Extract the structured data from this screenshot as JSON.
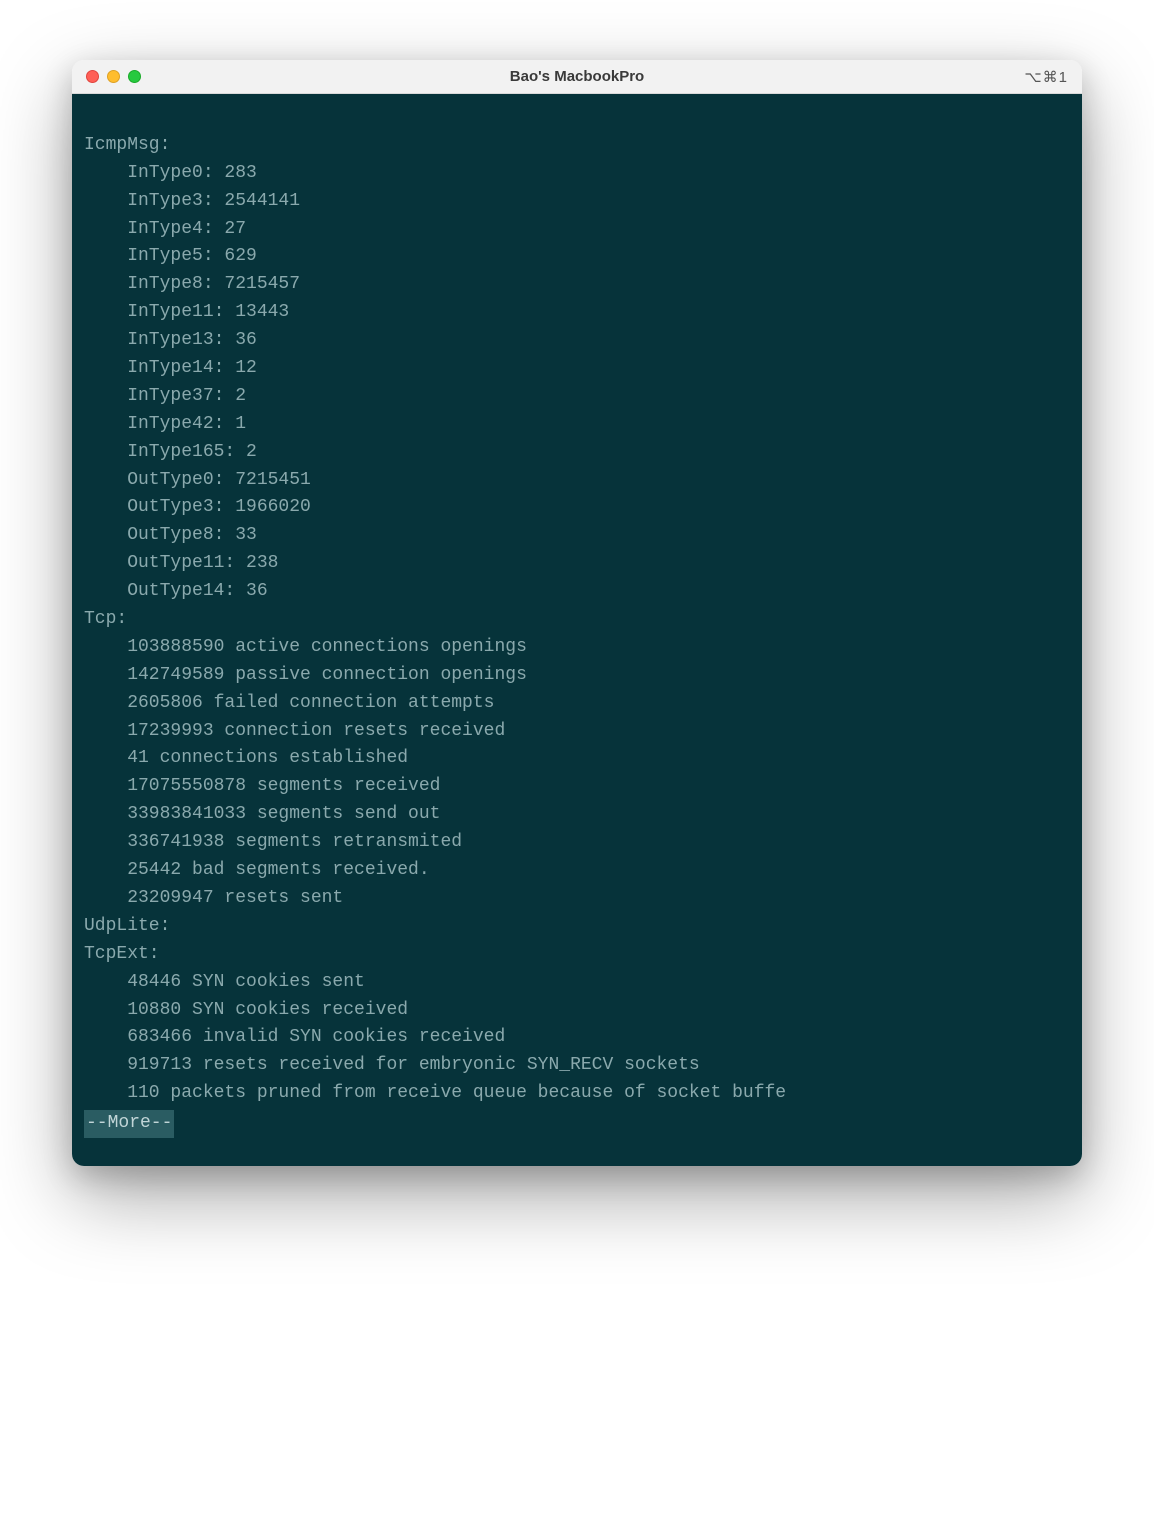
{
  "window": {
    "title": "Bao's MacbookPro",
    "shortcut": "⌥⌘1"
  },
  "sections": {
    "icmpMsg": {
      "header": "IcmpMsg:",
      "lines": [
        "InType0: 283",
        "InType3: 2544141",
        "InType4: 27",
        "InType5: 629",
        "InType8: 7215457",
        "InType11: 13443",
        "InType13: 36",
        "InType14: 12",
        "InType37: 2",
        "InType42: 1",
        "InType165: 2",
        "OutType0: 7215451",
        "OutType3: 1966020",
        "OutType8: 33",
        "OutType11: 238",
        "OutType14: 36"
      ]
    },
    "tcp": {
      "header": "Tcp:",
      "lines": [
        "103888590 active connections openings",
        "142749589 passive connection openings",
        "2605806 failed connection attempts",
        "17239993 connection resets received",
        "41 connections established",
        "17075550878 segments received",
        "33983841033 segments send out",
        "336741938 segments retransmited",
        "25442 bad segments received.",
        "23209947 resets sent"
      ]
    },
    "udpLite": {
      "header": "UdpLite:"
    },
    "tcpExt": {
      "header": "TcpExt:",
      "lines": [
        "48446 SYN cookies sent",
        "10880 SYN cookies received",
        "683466 invalid SYN cookies received",
        "919713 resets received for embryonic SYN_RECV sockets",
        "110 packets pruned from receive queue because of socket buffe"
      ]
    }
  },
  "pager": {
    "more": "--More--"
  }
}
